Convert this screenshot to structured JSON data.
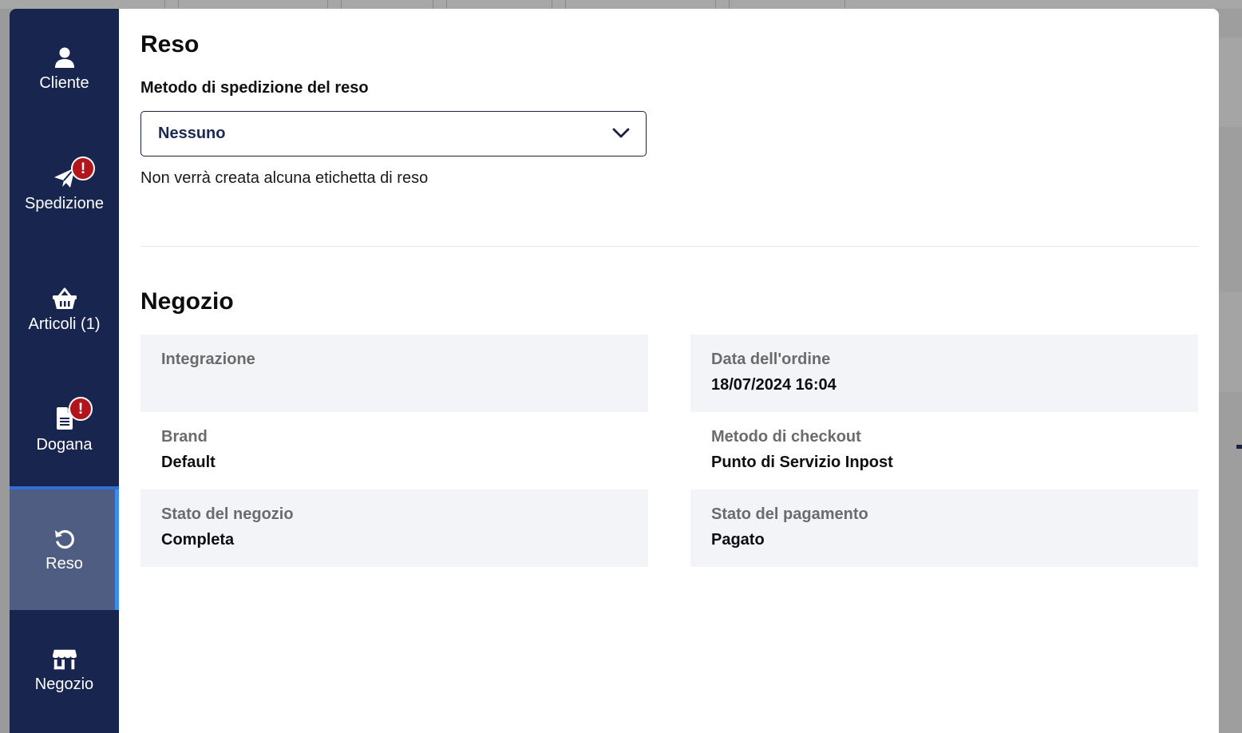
{
  "sidebar": {
    "items": [
      {
        "label": "Cliente",
        "icon": "user-icon",
        "alert": false,
        "active": false
      },
      {
        "label": "Spedizione",
        "icon": "paper-plane-icon",
        "alert": true,
        "active": false
      },
      {
        "label": "Articoli (1)",
        "icon": "basket-icon",
        "alert": false,
        "active": false
      },
      {
        "label": "Dogana",
        "icon": "document-icon",
        "alert": true,
        "active": false
      },
      {
        "label": "Reso",
        "icon": "undo-icon",
        "alert": false,
        "active": true
      },
      {
        "label": "Negozio",
        "icon": "store-icon",
        "alert": false,
        "active": false
      }
    ],
    "badge_text": "!"
  },
  "reso": {
    "title": "Reso",
    "shipping_method_label": "Metodo di spedizione del reso",
    "shipping_method_value": "Nessuno",
    "helper_text": "Non verrà creata alcuna etichetta di reso"
  },
  "negozio": {
    "title": "Negozio",
    "fields": {
      "integrazione": {
        "label": "Integrazione",
        "value": ""
      },
      "data_ordine": {
        "label": "Data dell'ordine",
        "value": "18/07/2024 16:04"
      },
      "brand": {
        "label": "Brand",
        "value": "Default"
      },
      "metodo_checkout": {
        "label": "Metodo di checkout",
        "value": "Punto di Servizio Inpost"
      },
      "stato_negozio": {
        "label": "Stato del negozio",
        "value": "Completa"
      },
      "stato_pagamento": {
        "label": "Stato del pagamento",
        "value": "Pagato"
      }
    }
  },
  "colors": {
    "sidebar_bg": "#18264f",
    "active_bg": "#4f5d82",
    "active_indicator": "#3a8df0",
    "alert_badge": "#b3151c",
    "cell_shade": "#f3f4f7"
  }
}
